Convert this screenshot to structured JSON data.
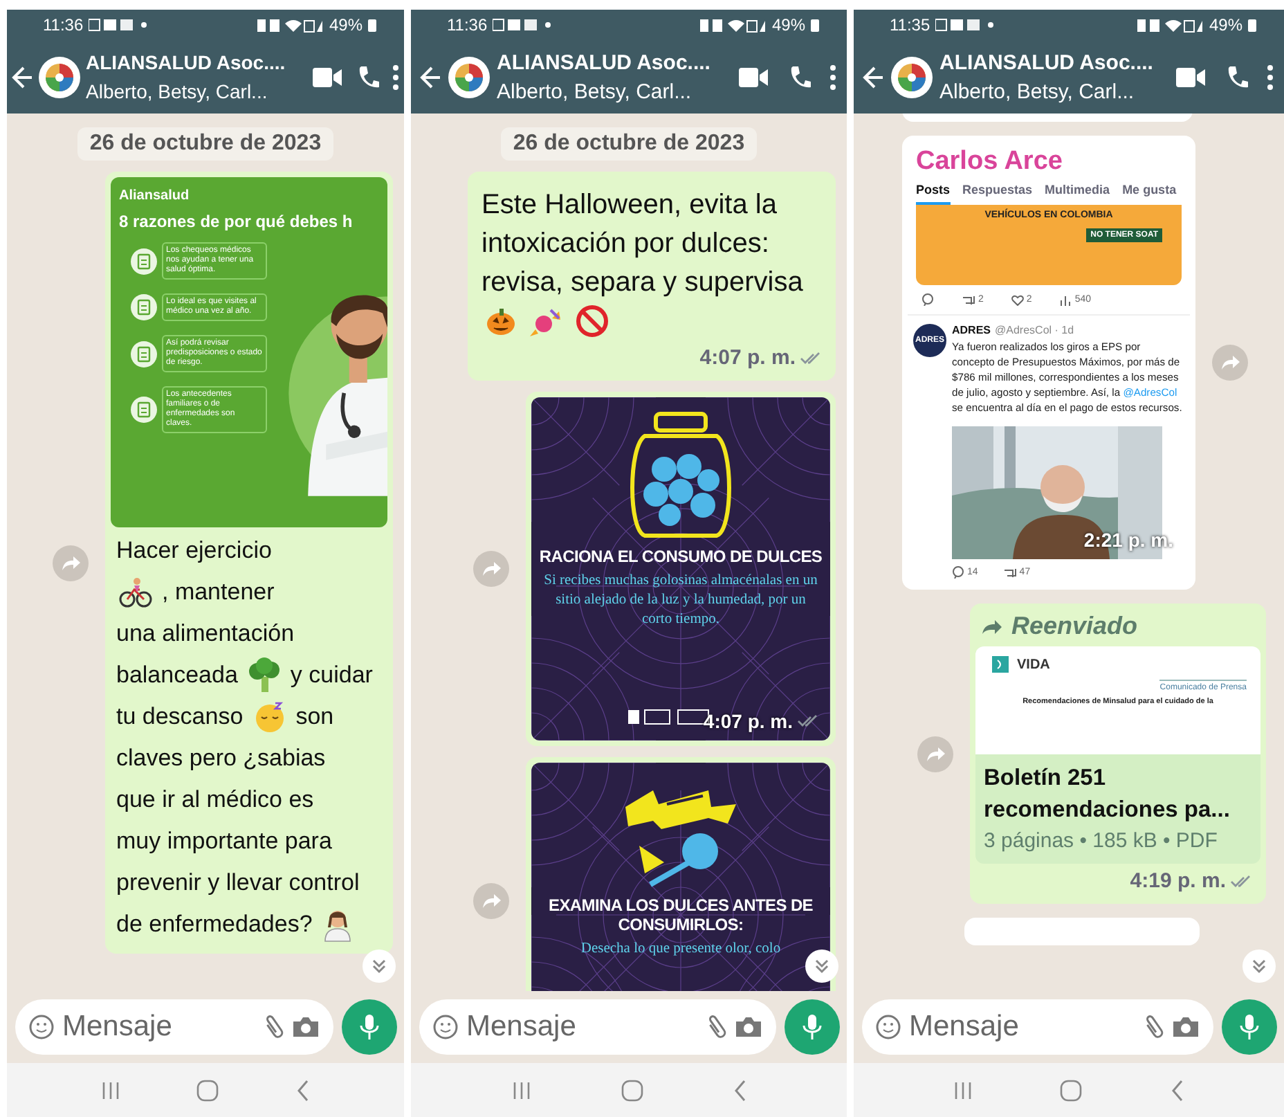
{
  "phones": [
    {
      "status_bar": {
        "time": "11:36",
        "battery": "49%"
      },
      "header": {
        "title": "ALIANSALUD Asoc....",
        "subtitle": "Alberto, Betsy, Carl..."
      },
      "messages": [
        {
          "kind": "date",
          "text": "26 de octubre de 2023"
        },
        {
          "kind": "image_text",
          "outgoing": true,
          "forward": true,
          "image": {
            "kind": "health_infographic",
            "brand": "Aliansalud",
            "title": "8 razones de por qué debes h",
            "items": [
              "Los chequeos médicos nos ayudan a tener una salud óptima.",
              "Lo ideal es que visites al médico una vez al año.",
              "Así podrá revisar predisposiciones o estado de riesgo.",
              "Los antecedentes familiares o de enfermedades son claves."
            ]
          },
          "lines": [
            [
              {
                "kind": "text",
                "text": "Hacer ejercicio"
              }
            ],
            [
              {
                "kind": "cyclist"
              },
              {
                "kind": "text",
                "text": ", mantener"
              }
            ],
            [
              {
                "kind": "text",
                "text": "una alimentación"
              }
            ],
            [
              {
                "kind": "text",
                "text": "balanceada"
              },
              {
                "kind": "broccoli"
              },
              {
                "kind": "text",
                "text": "y cuidar"
              }
            ],
            [
              {
                "kind": "text",
                "text": "tu descanso"
              },
              {
                "kind": "sleepy"
              },
              {
                "kind": "text",
                "text": "son"
              }
            ],
            [
              {
                "kind": "text",
                "text": "claves pero ¿sabias"
              }
            ],
            [
              {
                "kind": "text",
                "text": "que ir al médico es"
              }
            ],
            [
              {
                "kind": "text",
                "text": "muy importante para"
              }
            ],
            [
              {
                "kind": "text",
                "text": "prevenir y llevar control"
              }
            ],
            [
              {
                "kind": "text",
                "text": "de enfermedades?"
              },
              {
                "kind": "health_worker"
              }
            ]
          ]
        }
      ],
      "scroll_down_button": true,
      "composer": {
        "placeholder": "Mensaje"
      }
    },
    {
      "status_bar": {
        "time": "11:36",
        "battery": "49%"
      },
      "header": {
        "title": "ALIANSALUD Asoc....",
        "subtitle": "Alberto, Betsy, Carl..."
      },
      "messages": [
        {
          "kind": "date",
          "text": "26 de octubre de 2023"
        },
        {
          "kind": "text",
          "outgoing": true,
          "forward": false,
          "lines": [
            [
              {
                "kind": "text",
                "text": "Este Halloween, evita la"
              }
            ],
            [
              {
                "kind": "text",
                "text": "intoxicación por dulces:"
              }
            ],
            [
              {
                "kind": "text",
                "text": "revisa, separa y supervisa"
              }
            ],
            [
              {
                "kind": "pumpkin"
              },
              {
                "kind": "candy"
              },
              {
                "kind": "prohibited"
              }
            ]
          ],
          "time": "4:07 p. m.",
          "read": false
        },
        {
          "outgoing": true,
          "forward": true,
          "image": {
            "kind": "candy_jar_poster",
            "title": "RACIONA EL CONSUMO DE DULCES",
            "body": "Si recibes muchas golosinas almacénalas en un sitio alejado de la luz y la humedad, por un corto tiempo."
          },
          "time": "4:07 p. m.",
          "read": false
        },
        {
          "outgoing": true,
          "forward": true,
          "image": {
            "kind": "candy_poster",
            "title": "EXAMINA LOS DULCES ANTES DE CONSUMIRLOS:",
            "body": "Desecha lo que presente olor, colo"
          }
        }
      ],
      "scroll_down_button": true,
      "composer": {
        "placeholder": "Mensaje"
      }
    },
    {
      "status_bar": {
        "time": "11:35",
        "battery": "49%"
      },
      "header": {
        "title": "ALIANSALUD Asoc....",
        "subtitle": "Alberto, Betsy, Carl..."
      },
      "messages": [
        {
          "kind": "clipped_top",
          "outgoing": false
        },
        {
          "kind": "tweet_screenshot",
          "outgoing": false,
          "forward": true,
          "profile": {
            "name": "Carlos Arce",
            "tabs": [
              {
                "label": "Posts",
                "selected": true
              },
              {
                "label": "Respuestas",
                "selected": false
              },
              {
                "label": "Multimedia",
                "selected": false
              },
              {
                "label": "Me gusta",
                "selected": false
              }
            ]
          },
          "banner": {
            "title": "VEHÍCULOS EN COLOMBIA",
            "badge": "NO TENER SOAT"
          },
          "actions": [
            "2",
            "2",
            "540"
          ],
          "tweet": {
            "avatar": "ADRES",
            "author": "ADRES",
            "handle": "@AdresCol · 1d",
            "text": "Ya fueron realizados los giros a EPS por concepto de Presupuestos Máximos, por más de $786 mil millones, correspondientes a los meses de julio, agosto y septiembre. Así, la ",
            "mention": "@AdresCol",
            "text_after": " se encuentra al día en el pago de estos recursos.",
            "actions": [
              "14",
              "47"
            ]
          },
          "time": "2:21 p. m."
        },
        {
          "kind": "document",
          "outgoing": true,
          "forward": true,
          "forwarded_label": "Reenviado",
          "preview": {
            "logo": "VIDA",
            "tag": "Comunicado de Prensa",
            "headline": "Recomendaciones de Minsalud para el cuidado de la"
          },
          "title": "Boletín 251 recomendaciones pa...",
          "meta": "3 páginas • 185 kB • PDF",
          "time": "4:19 p. m.",
          "read": false
        },
        {
          "kind": "clipped_bottom",
          "outgoing": false
        }
      ],
      "scroll_down_button": true,
      "composer": {
        "placeholder": "Mensaje"
      }
    }
  ]
}
